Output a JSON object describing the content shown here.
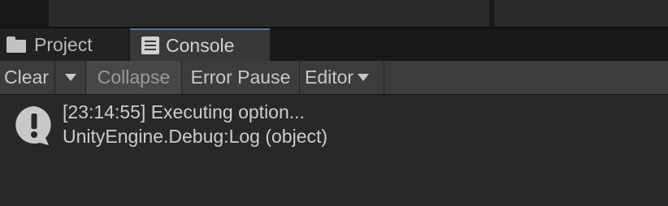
{
  "tabs": [
    {
      "label": "Project",
      "icon": "folder-icon",
      "active": false
    },
    {
      "label": "Console",
      "icon": "console-icon",
      "active": true
    }
  ],
  "toolbar": {
    "clear_label": "Clear",
    "collapse_label": "Collapse",
    "error_pause_label": "Error Pause",
    "editor_label": "Editor"
  },
  "log": {
    "entries": [
      {
        "icon": "info-icon",
        "line1": "[23:14:55] Executing option...",
        "line2": "UnityEngine.Debug:Log (object)"
      }
    ]
  },
  "colors": {
    "background": "#282828",
    "toolbar": "#3c3c3c",
    "active_tab": "#383838",
    "active_tab_accent": "#3a79bb"
  }
}
